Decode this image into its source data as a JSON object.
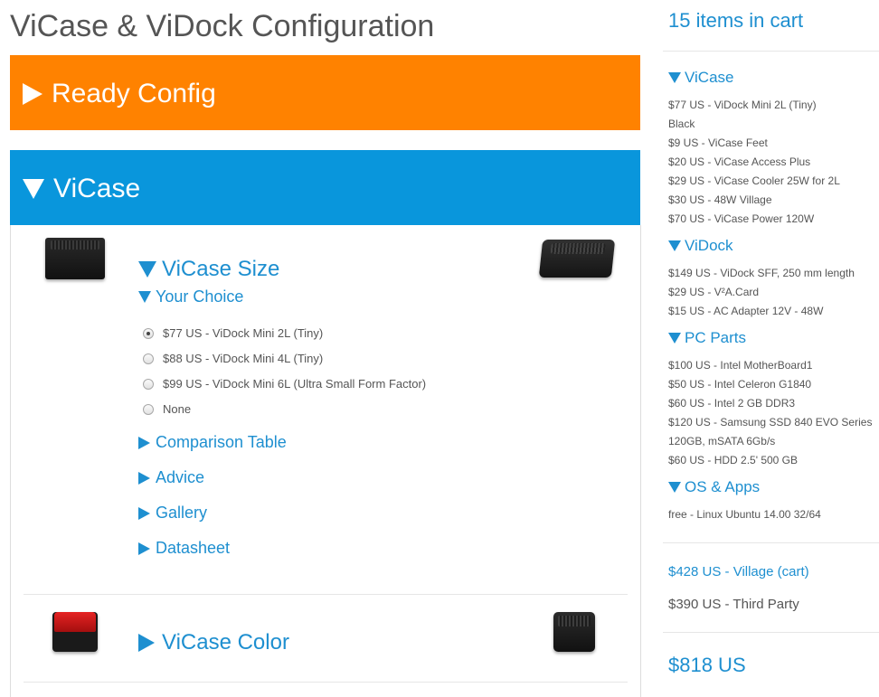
{
  "page": {
    "title": "ViCase & ViDock Configuration"
  },
  "panels": {
    "ready_config": {
      "label": "Ready Config",
      "color": "#ff8200"
    },
    "vicase": {
      "label": "ViCase",
      "color": "#0996dc"
    }
  },
  "vicase_size": {
    "heading": "ViCase Size",
    "choice_heading": "Your Choice",
    "options": [
      {
        "label": "$77 US - ViDock Mini 2L (Tiny)",
        "selected": true
      },
      {
        "label": "$88 US - ViDock Mini 4L (Tiny)",
        "selected": false
      },
      {
        "label": "$99 US - ViDock Mini 6L (Ultra Small Form Factor)",
        "selected": false
      },
      {
        "label": "None",
        "selected": false
      }
    ],
    "links": [
      "Comparison Table",
      "Advice",
      "Gallery",
      "Datasheet"
    ]
  },
  "vicase_color": {
    "heading": "ViCase Color"
  },
  "cart": {
    "count_label": "15 items in cart",
    "groups": [
      {
        "title": "ViCase",
        "items": [
          "$77 US - ViDock Mini 2L (Tiny)",
          "Black",
          "$9 US - ViCase Feet",
          "$20 US - ViCase Access Plus",
          "$29 US - ViCase Cooler 25W for 2L",
          "$30 US - 48W Village",
          "$70 US - ViCase Power 120W"
        ]
      },
      {
        "title": "ViDock",
        "items": [
          "$149 US - ViDock SFF, 250 mm length",
          "$29 US - V²A.Card",
          "$15 US - AC Adapter 12V - 48W"
        ]
      },
      {
        "title": "PC Parts",
        "items": [
          "$100 US - Intel MotherBoard1",
          "$50 US - Intel Celeron G1840",
          "$60 US - Intel 2 GB DDR3",
          "$120 US - Samsung SSD 840 EVO Series",
          "120GB, mSATA 6Gb/s",
          "$60 US - HDD 2.5' 500 GB"
        ]
      },
      {
        "title": "OS & Apps",
        "items": [
          "free - Linux Ubuntu 14.00 32/64"
        ]
      }
    ],
    "village_total": "$428 US - Village (cart)",
    "third_party": "$390 US - Third Party",
    "grand_total": "$818 US"
  },
  "colors": {
    "accent_blue": "#1e8fd0",
    "orange": "#ff8200",
    "header_blue": "#0996dc",
    "text_gray": "#555555"
  }
}
